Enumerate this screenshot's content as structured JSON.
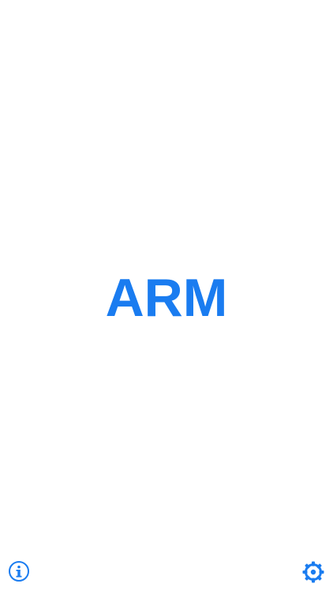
{
  "main": {
    "label": "ARM"
  },
  "toolbar": {
    "info_icon": "info-icon",
    "settings_icon": "gear-icon"
  },
  "colors": {
    "accent": "#1a7cf0",
    "background": "#ffffff"
  }
}
